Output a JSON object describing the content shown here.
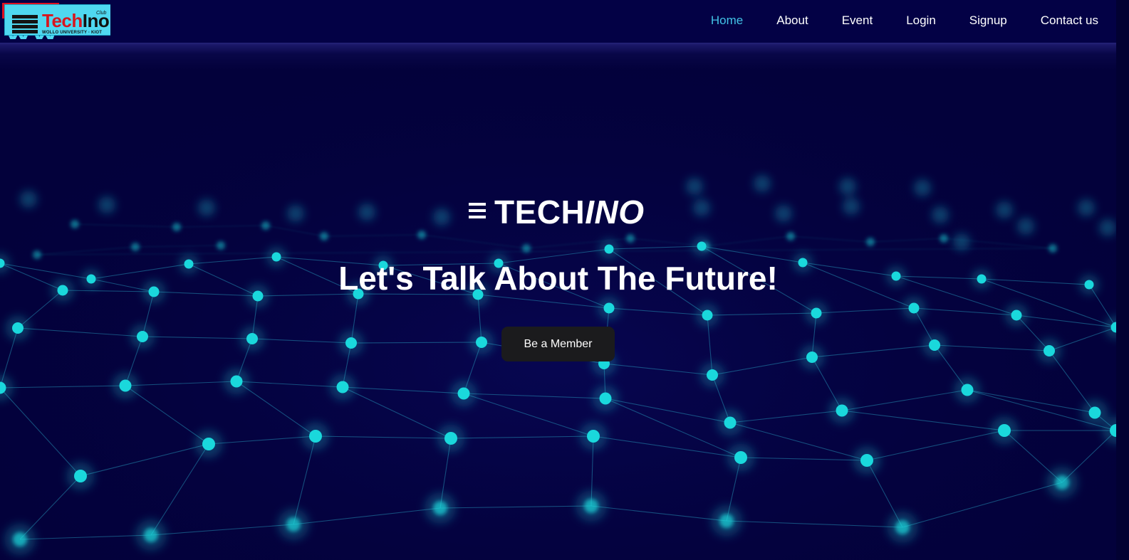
{
  "logo": {
    "word_tech": "Tech",
    "word_ino": "Ino",
    "club": "Club",
    "subtitle": "WOLLO UNIVERSITY · KIOT",
    "colors": {
      "background": "#4fd8f0",
      "tech": "#d8161e",
      "accent": "#e01020"
    }
  },
  "nav": {
    "items": [
      {
        "label": "Home",
        "active": true
      },
      {
        "label": "About",
        "active": false
      },
      {
        "label": "Event",
        "active": false
      },
      {
        "label": "Login",
        "active": false
      },
      {
        "label": "Signup",
        "active": false
      },
      {
        "label": "Contact us",
        "active": false
      }
    ],
    "active_color": "#42c2e6"
  },
  "hero": {
    "brand_regular": "TECH",
    "brand_italic": "INO",
    "title": "Let's Talk About The Future!",
    "cta_label": "Be a Member",
    "icon": "menu-bars-icon"
  },
  "theme": {
    "background": "#03013b",
    "header": "#030145",
    "node": "#1ad8dc",
    "button": "#1b1b1d"
  }
}
